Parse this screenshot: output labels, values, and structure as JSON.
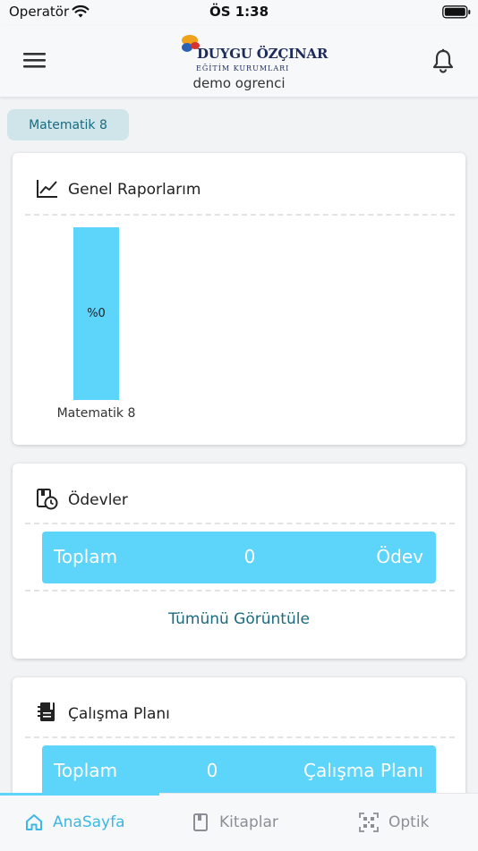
{
  "status_bar": {
    "carrier": "Operatör",
    "time": "ÖS 1:38"
  },
  "header": {
    "logo_name": "DUYGU ÖZÇINAR",
    "logo_sub": "EĞİTİM KURUMLARI",
    "user_name": "demo ogrenci"
  },
  "class_chip": {
    "label": "Matematik 8"
  },
  "reports": {
    "title": "Genel Raporlarım",
    "chart_data": {
      "type": "bar",
      "categories": [
        "Matematik 8"
      ],
      "values": [
        0
      ],
      "value_labels": [
        "%0"
      ]
    }
  },
  "homework": {
    "title": "Ödevler",
    "total_label": "Toplam",
    "total_value": "0",
    "unit": "Ödev",
    "view_all": "Tümünü Görüntüle"
  },
  "study_plan": {
    "title": "Çalışma Planı",
    "total_label": "Toplam",
    "total_value": "0",
    "unit": "Çalışma Planı"
  },
  "tabs": [
    {
      "label": "AnaSayfa",
      "icon": "home-icon",
      "active": true
    },
    {
      "label": "Kitaplar",
      "icon": "book-icon",
      "active": false
    },
    {
      "label": "Optik",
      "icon": "qr-code-icon",
      "active": false
    }
  ],
  "colors": {
    "accent": "#5dd4fa",
    "link": "#1b6b7e",
    "chip_bg": "#cfe5ea",
    "inactive_tab": "#8a8f96"
  }
}
